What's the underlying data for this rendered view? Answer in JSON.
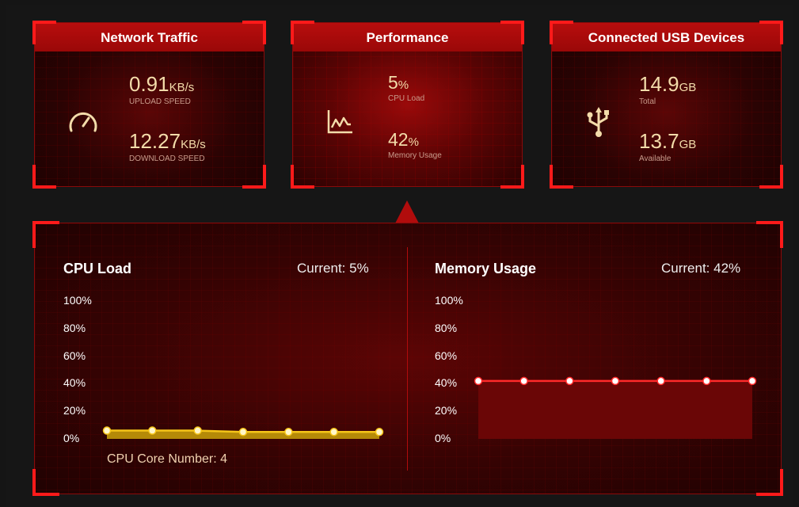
{
  "cards": {
    "network": {
      "title": "Network Traffic",
      "icon": "speedometer-icon",
      "upload_value": "0.91",
      "upload_unit": "KB/s",
      "upload_label": "UPLOAD SPEED",
      "download_value": "12.27",
      "download_unit": "KB/s",
      "download_label": "DOWNLOAD SPEED"
    },
    "performance": {
      "title": "Performance",
      "icon": "line-chart-icon",
      "cpu_value": "5",
      "cpu_unit": "%",
      "cpu_label": "CPU Load",
      "mem_value": "42",
      "mem_unit": "%",
      "mem_label": "Memory Usage"
    },
    "usb": {
      "title": "Connected USB Devices",
      "icon": "usb-icon",
      "total_value": "14.9",
      "total_unit": "GB",
      "total_label": "Total",
      "avail_value": "13.7",
      "avail_unit": "GB",
      "avail_label": "Available"
    }
  },
  "cpu": {
    "title": "CPU Load",
    "current": "Current: 5%",
    "core_text": "CPU Core Number: 4"
  },
  "memory": {
    "title": "Memory Usage",
    "current": "Current: 42%"
  },
  "y_ticks": [
    "100%",
    "80%",
    "60%",
    "40%",
    "20%",
    "0%"
  ],
  "colors": {
    "accent": "#ff1a1a",
    "cpu_line": "#f5c518",
    "cpu_fill": "#b58a08",
    "mem_line": "#ff2a2a",
    "mem_fill": "#6a0606"
  },
  "chart_data": [
    {
      "type": "area",
      "title": "CPU Load",
      "ylim": [
        0,
        100
      ],
      "y_ticks": [
        "100%",
        "80%",
        "60%",
        "40%",
        "20%",
        "0%"
      ],
      "values": [
        6,
        6,
        6,
        5,
        5,
        5,
        5
      ]
    },
    {
      "type": "area",
      "title": "Memory Usage",
      "ylim": [
        0,
        100
      ],
      "y_ticks": [
        "100%",
        "80%",
        "60%",
        "40%",
        "20%",
        "0%"
      ],
      "values": [
        42,
        42,
        42,
        42,
        42,
        42,
        42
      ]
    }
  ]
}
